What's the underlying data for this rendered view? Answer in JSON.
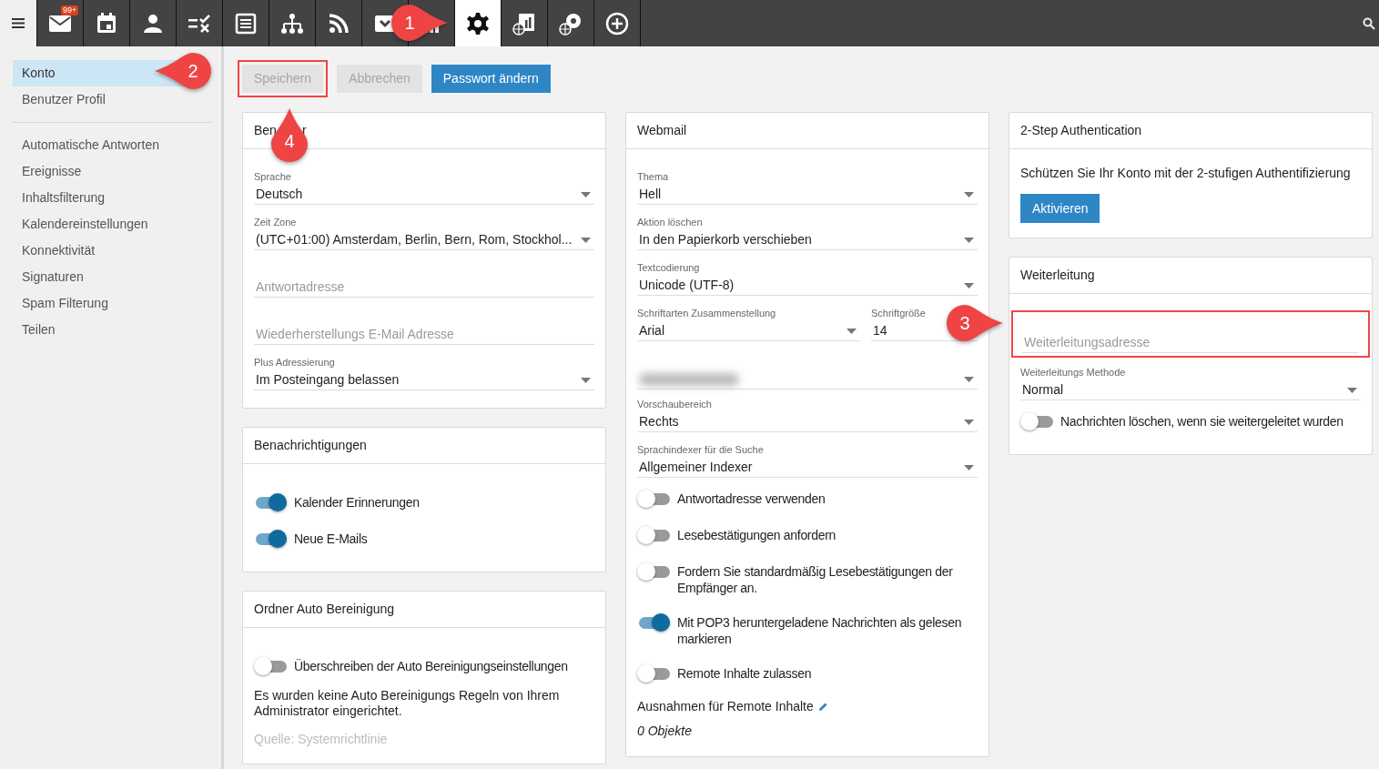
{
  "toolbar": {
    "tiles": [
      {
        "kind": "mail",
        "badge": "99+",
        "selected": false
      },
      {
        "kind": "calendar",
        "selected": false
      },
      {
        "kind": "person",
        "selected": false
      },
      {
        "kind": "tasks",
        "selected": false
      },
      {
        "kind": "notes",
        "selected": false
      },
      {
        "kind": "tree",
        "selected": false
      },
      {
        "kind": "rss",
        "selected": false
      },
      {
        "kind": "inbox",
        "selected": false
      },
      {
        "kind": "bars",
        "selected": false
      },
      {
        "kind": "gear",
        "selected": true
      },
      {
        "kind": "report-globe",
        "selected": false
      },
      {
        "kind": "gear-globe",
        "selected": false
      },
      {
        "kind": "plus",
        "selected": false
      }
    ]
  },
  "sidebar": {
    "groups": [
      [
        {
          "label": "Konto",
          "selected": true
        },
        {
          "label": "Benutzer Profil",
          "selected": false
        }
      ],
      [
        {
          "label": "Automatische Antworten",
          "selected": false
        },
        {
          "label": "Ereignisse",
          "selected": false
        },
        {
          "label": "Inhaltsfilterung",
          "selected": false
        },
        {
          "label": "Kalendereinstellungen",
          "selected": false
        },
        {
          "label": "Konnektivität",
          "selected": false
        },
        {
          "label": "Signaturen",
          "selected": false
        },
        {
          "label": "Spam Filterung",
          "selected": false
        },
        {
          "label": "Teilen",
          "selected": false
        }
      ]
    ]
  },
  "actions": [
    {
      "label": "Speichern",
      "kind": "secondary",
      "disabled": true,
      "highlighted": true
    },
    {
      "label": "Abbrechen",
      "kind": "secondary",
      "disabled": true,
      "highlighted": false
    },
    {
      "label": "Passwort ändern",
      "kind": "primary",
      "disabled": false,
      "highlighted": false
    }
  ],
  "columns": [
    [
      {
        "title_parts": [
          "Ben",
          "r"
        ],
        "rows": [
          {
            "kind": "select",
            "label": "Sprache",
            "value": "Deutsch"
          },
          {
            "kind": "select",
            "label": "Zeit Zone",
            "value": "(UTC+01:00) Amsterdam, Berlin, Bern, Rom, Stockhol..."
          },
          {
            "kind": "input",
            "placeholder": "Antwortadresse",
            "highlighted": false
          },
          {
            "kind": "input",
            "placeholder": "Wiederherstellungs E-Mail Adresse",
            "highlighted": false
          },
          {
            "kind": "select",
            "label": "Plus Adressierung",
            "value": "Im Posteingang belassen"
          }
        ]
      },
      {
        "title": "Benachrichtigungen",
        "rows": [
          {
            "kind": "toggle",
            "label": "Kalender Erinnerungen",
            "on": true
          },
          {
            "kind": "toggle",
            "label": "Neue E-Mails",
            "on": true
          }
        ]
      },
      {
        "title": "Ordner Auto Bereinigung",
        "rows": [
          {
            "kind": "toggle",
            "label": "Überschreiben der Auto Bereinigungseinstellungen",
            "on": false
          },
          {
            "kind": "text",
            "text": "Es wurden keine Auto Bereinigungs Regeln von Ihrem Administrator eingerichtet."
          },
          {
            "kind": "muted",
            "text": "Quelle: Systemrichtlinie"
          }
        ]
      }
    ],
    [
      {
        "title": "Webmail",
        "rows": [
          {
            "kind": "select",
            "label": "Thema",
            "value": "Hell"
          },
          {
            "kind": "select",
            "label": "Aktion löschen",
            "value": "In den Papierkorb verschieben"
          },
          {
            "kind": "select",
            "label": "Textcodierung",
            "value": "Unicode (UTF-8)"
          },
          {
            "kind": "pair",
            "fields": [
              {
                "kind": "select",
                "label": "Schriftarten Zusammenstellung",
                "value": "Arial"
              },
              {
                "kind": "plain",
                "label": "Schriftgröße",
                "value": "14"
              }
            ]
          },
          {
            "kind": "blurred"
          },
          {
            "kind": "select",
            "label": "Vorschaubereich",
            "value": "Rechts"
          },
          {
            "kind": "select",
            "label": "Sprachindexer für die Suche",
            "value": "Allgemeiner Indexer"
          },
          {
            "kind": "toggle",
            "label": "Antwortadresse verwenden",
            "on": false
          },
          {
            "kind": "toggle",
            "label": "Lesebestätigungen anfordern",
            "on": false
          },
          {
            "kind": "toggle",
            "label": "Fordern Sie standardmäßig Lesebestätigungen der Empfänger an.",
            "on": false
          },
          {
            "kind": "toggle",
            "label": "Mit POP3 heruntergeladene Nachrichten als gelesen markieren",
            "on": true
          },
          {
            "kind": "toggle",
            "label": "Remote Inhalte zulassen",
            "on": false
          },
          {
            "kind": "edit-link",
            "text": "Ausnahmen für Remote Inhalte"
          },
          {
            "kind": "italic",
            "text": "0 Objekte"
          }
        ]
      }
    ],
    [
      {
        "title": "2-Step Authentication",
        "rows": [
          {
            "kind": "text",
            "text": "Schützen Sie Ihr Konto mit der 2-stufigen Authentifizierung"
          },
          {
            "kind": "button",
            "label": "Aktivieren"
          }
        ]
      },
      {
        "title": "Weiterleitung",
        "rows": [
          {
            "kind": "input",
            "placeholder": "Weiterleitungsadresse",
            "highlighted": true
          },
          {
            "kind": "select",
            "label": "Weiterleitungs Methode",
            "value": "Normal"
          },
          {
            "kind": "toggle",
            "label": "Nachrichten löschen, wenn sie weitergeleitet wurden",
            "on": false
          }
        ]
      }
    ]
  ],
  "callouts": [
    {
      "label": "1"
    },
    {
      "label": "2"
    },
    {
      "label": "3"
    },
    {
      "label": "4"
    }
  ]
}
